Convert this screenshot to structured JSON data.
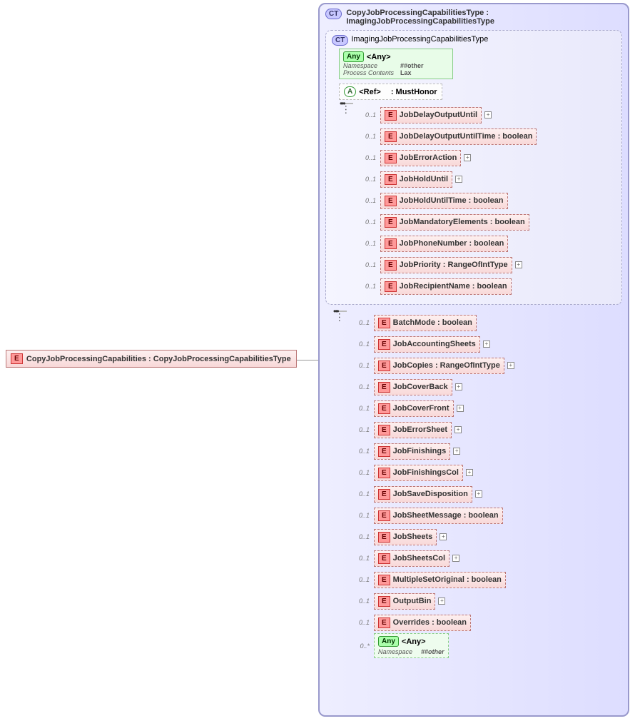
{
  "root": {
    "badge": "E",
    "label": "CopyJobProcessingCapabilities : CopyJobProcessingCapabilitiesType"
  },
  "outerType": {
    "badge": "CT",
    "name": "CopyJobProcessingCapabilitiesType",
    "base": "ImagingJobProcessingCapabilitiesType"
  },
  "innerType": {
    "badge": "CT",
    "name": "ImagingJobProcessingCapabilitiesType",
    "any": {
      "badge": "Any",
      "label": "<Any>",
      "namespace_key": "Namespace",
      "namespace_val": "##other",
      "process_key": "Process Contents",
      "process_val": "Lax"
    },
    "ref": {
      "badge": "A",
      "label": "<Ref>",
      "target": ": MustHonor"
    },
    "children": [
      {
        "card": "0..1",
        "label": "JobDelayOutputUntil",
        "expandable": true
      },
      {
        "card": "0..1",
        "label": "JobDelayOutputUntilTime : boolean"
      },
      {
        "card": "0..1",
        "label": "JobErrorAction",
        "expandable": true
      },
      {
        "card": "0..1",
        "label": "JobHoldUntil",
        "expandable": true
      },
      {
        "card": "0..1",
        "label": "JobHoldUntilTime : boolean"
      },
      {
        "card": "0..1",
        "label": "JobMandatoryElements : boolean"
      },
      {
        "card": "0..1",
        "label": "JobPhoneNumber : boolean"
      },
      {
        "card": "0..1",
        "label": "JobPriority : RangeOfIntType",
        "expandable": true
      },
      {
        "card": "0..1",
        "label": "JobRecipientName : boolean"
      }
    ]
  },
  "outerChildren": [
    {
      "card": "0..1",
      "label": "BatchMode : boolean"
    },
    {
      "card": "0..1",
      "label": "JobAccountingSheets",
      "expandable": true
    },
    {
      "card": "0..1",
      "label": "JobCopies : RangeOfIntType",
      "expandable": true
    },
    {
      "card": "0..1",
      "label": "JobCoverBack",
      "expandable": true
    },
    {
      "card": "0..1",
      "label": "JobCoverFront",
      "expandable": true
    },
    {
      "card": "0..1",
      "label": "JobErrorSheet",
      "expandable": true
    },
    {
      "card": "0..1",
      "label": "JobFinishings",
      "expandable": true
    },
    {
      "card": "0..1",
      "label": "JobFinishingsCol",
      "expandable": true
    },
    {
      "card": "0..1",
      "label": "JobSaveDisposition",
      "expandable": true
    },
    {
      "card": "0..1",
      "label": "JobSheetMessage : boolean"
    },
    {
      "card": "0..1",
      "label": "JobSheets",
      "expandable": true
    },
    {
      "card": "0..1",
      "label": "JobSheetsCol",
      "expandable": true
    },
    {
      "card": "0..1",
      "label": "MultipleSetOriginal : boolean"
    },
    {
      "card": "0..1",
      "label": "OutputBin",
      "expandable": true
    },
    {
      "card": "0..1",
      "label": "Overrides : boolean"
    },
    {
      "card": "0..*",
      "label": "<Any>",
      "any": true,
      "ns_key": "Namespace",
      "ns_val": "##other"
    }
  ],
  "badges": {
    "E": "E",
    "CT": "CT",
    "A": "A",
    "Any": "Any"
  }
}
